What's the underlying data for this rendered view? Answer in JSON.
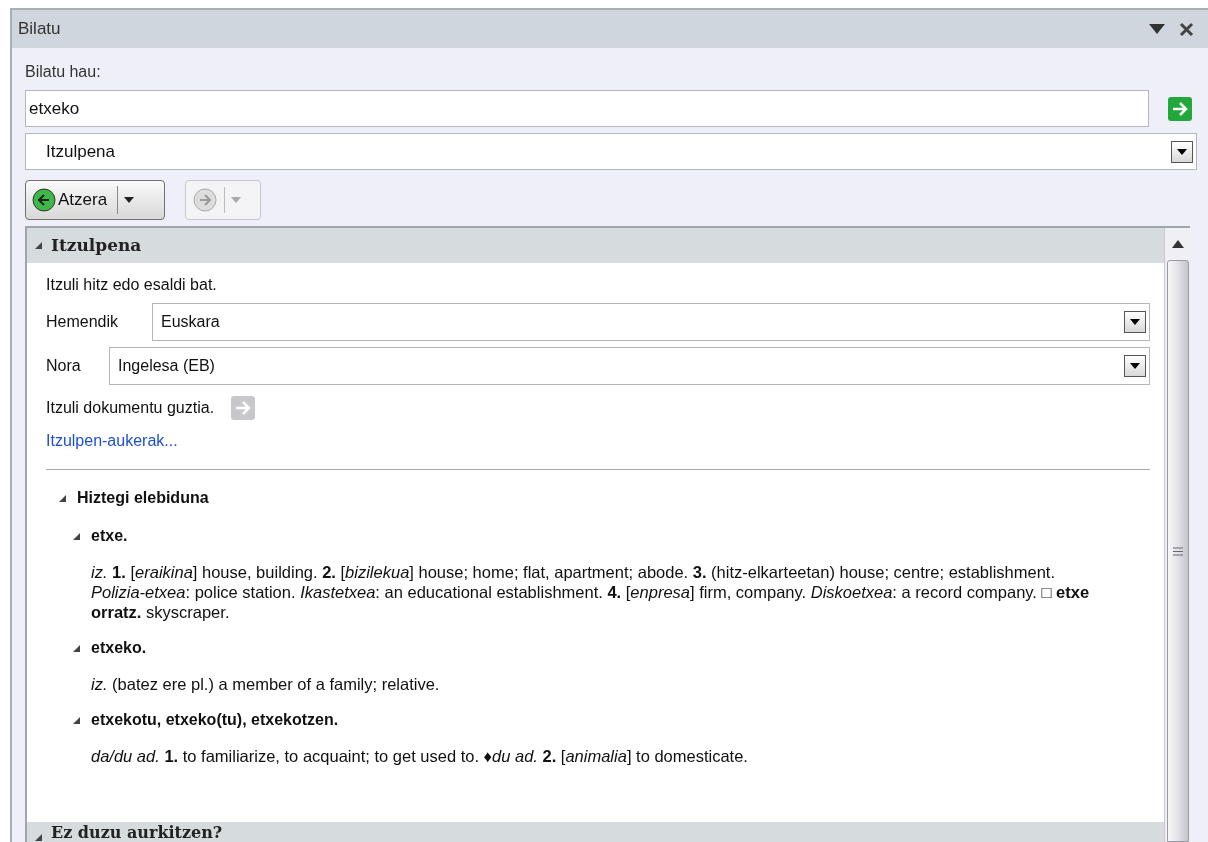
{
  "panel": {
    "title": "Bilatu"
  },
  "search": {
    "label": "Bilatu hau:",
    "value": "etxeko"
  },
  "service": {
    "value": "Itzulpena"
  },
  "nav": {
    "back": {
      "label": "Atzera",
      "disabled": false
    },
    "forward": {
      "disabled": true
    }
  },
  "translation": {
    "title": "Itzulpena",
    "expanded": true,
    "intro": "Itzuli hitz edo esaldi bat.",
    "from": {
      "label": "Hemendik",
      "value": "Euskara"
    },
    "to": {
      "label": "Nora",
      "value": "Ingelesa (EB)"
    },
    "translate_document": {
      "label": "Itzuli dokumentu guztia.",
      "disabled": true
    },
    "options_link": "Itzulpen-aukerak...",
    "dictionary": {
      "title": "Hiztegi elebiduna",
      "expanded": true,
      "entries": [
        {
          "headword": "etxe.",
          "expanded": true,
          "definition": "*iz.* **1.** [*eraikina*] house, building. **2.** [*bizilekua*] house; home; flat, apartment; abode. **3.** (hitz-elkarteetan) house; centre; establishment. *Polizia-etxea*: police station. *Ikastetxea*: an educational establishment. **4.** [*enpresa*] firm, company. *Diskoetxea*: a record company. □ **etxe orratz.** skyscraper."
        },
        {
          "headword": "etxeko.",
          "expanded": true,
          "definition": "*iz.* (batez ere pl.) a member of a family; relative."
        },
        {
          "headword": "etxekotu, etxeko(tu), etxekotzen.",
          "expanded": true,
          "definition": "*da/du ad.* **1.** to familiarize, to acquaint; to get used to.  ♦*du ad.* **2.** [*animalia*] to domesticate."
        }
      ]
    }
  },
  "more_section": {
    "title": "Ez duzu aurkitzen?",
    "expanded": true
  }
}
